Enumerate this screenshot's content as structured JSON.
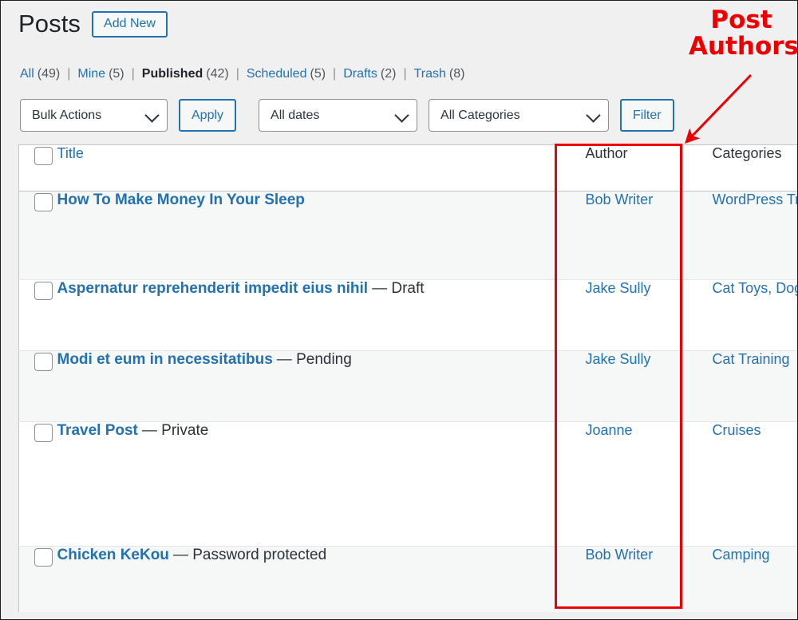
{
  "header": {
    "title": "Posts",
    "add_new_label": "Add New"
  },
  "status_links": [
    {
      "label": "All",
      "count": "(49)",
      "current": false
    },
    {
      "label": "Mine",
      "count": "(5)",
      "current": false
    },
    {
      "label": "Published",
      "count": "(42)",
      "current": true
    },
    {
      "label": "Scheduled",
      "count": "(5)",
      "current": false
    },
    {
      "label": "Drafts",
      "count": "(2)",
      "current": false
    },
    {
      "label": "Trash",
      "count": "(8)",
      "current": false
    }
  ],
  "separator": "|",
  "tablenav": {
    "bulk_actions_value": "Bulk Actions",
    "apply_label": "Apply",
    "dates_value": "All dates",
    "categories_value": "All Categories",
    "filter_label": "Filter"
  },
  "table": {
    "columns": {
      "title": "Title",
      "author": "Author",
      "categories": "Categories"
    },
    "rows": [
      {
        "title": "How To Make Money In Your Sleep",
        "state": "",
        "author": "Bob Writer",
        "categories": "WordPress Tr"
      },
      {
        "title": "Aspernatur reprehenderit impedit eius nihil",
        "state": "— Draft",
        "author": "Jake Sully",
        "categories": "Cat Toys, Dog"
      },
      {
        "title": "Modi et eum in necessitatibus",
        "state": "— Pending",
        "author": "Jake Sully",
        "categories": "Cat Training"
      },
      {
        "title": "Travel Post",
        "state": "— Private",
        "author": "Joanne",
        "categories": "Cruises"
      },
      {
        "title": "Chicken KeKou",
        "state": "— Password protected",
        "author": "Bob Writer",
        "categories": "Camping"
      }
    ]
  },
  "annotation": {
    "label_line1": "Post",
    "label_line2": "Authors",
    "color": "#ee0000"
  },
  "colors": {
    "link": "#2271b1",
    "text": "#1d2327",
    "muted": "#50575e",
    "row_alt": "#f6f7f7",
    "page_bg": "#f0f0f1",
    "annotation": "#ee0000"
  }
}
